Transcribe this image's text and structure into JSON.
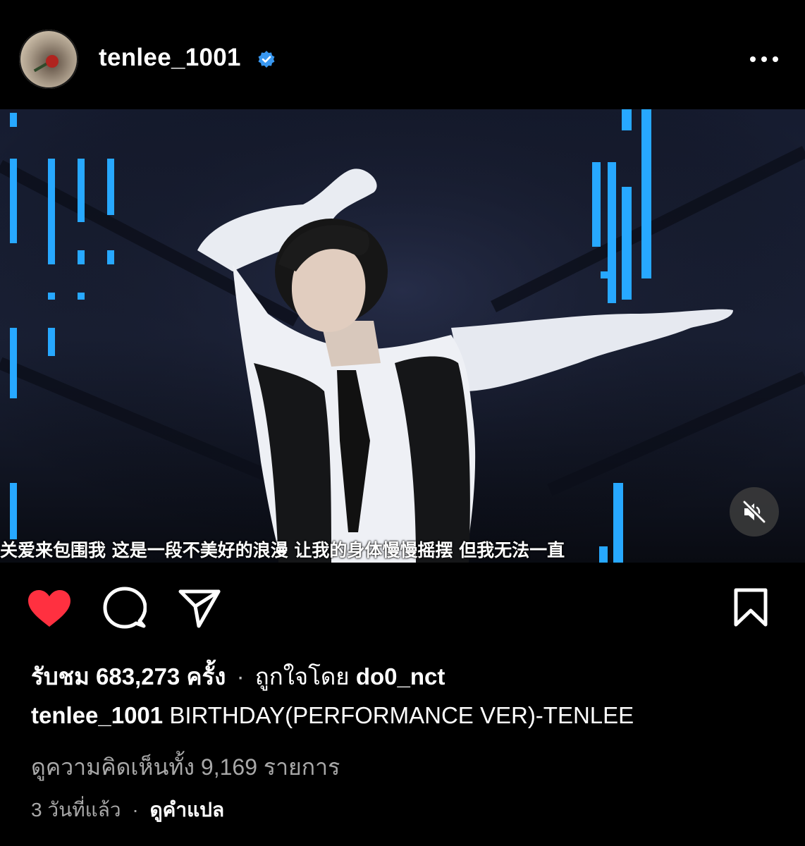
{
  "header": {
    "username": "tenlee_1001",
    "verified": true,
    "more_icon": "more-horizontal-icon"
  },
  "video": {
    "subtitle": "关爱来包围我 这是一段不美好的浪漫 让我的身体慢慢摇摆 但我无法一直",
    "mute_icon": "speaker-muted-icon"
  },
  "actions": {
    "like_icon": "heart-filled-icon",
    "comment_icon": "comment-bubble-icon",
    "share_icon": "send-paper-plane-icon",
    "save_icon": "bookmark-icon",
    "like_color": "#ff3040"
  },
  "stats": {
    "views_prefix": "รับชม",
    "views_count": "683,273",
    "views_suffix": "ครั้ง",
    "separator": "·",
    "liked_by_prefix": "ถูกใจโดย",
    "liked_by_user": "do0_nct"
  },
  "caption": {
    "username": "tenlee_1001",
    "text": "BIRTHDAY(PERFORMANCE VER)-TENLEE"
  },
  "comments": {
    "label": "ดูความคิดเห็นทั้ง 9,169 รายการ"
  },
  "meta": {
    "time_ago": "3 วันที่แล้ว",
    "separator": "·",
    "translate_label": "ดูคำแปล"
  }
}
